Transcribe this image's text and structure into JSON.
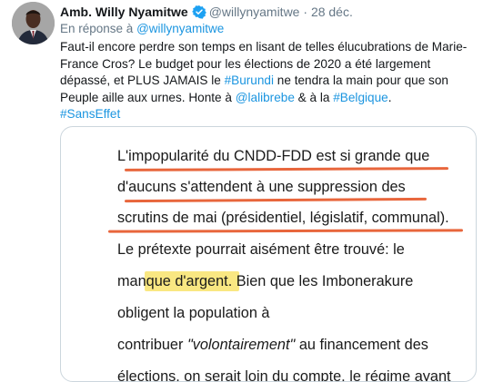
{
  "tweet": {
    "author_name": "Amb. Willy Nyamitwe",
    "verified_icon": "verified-badge-icon",
    "handle": "@willynyamitwe",
    "separator": "·",
    "date": "28 déc.",
    "reply_prefix": "En réponse à",
    "reply_handle": "@willynyamitwe",
    "text_1": "Faut-il encore perdre son temps en lisant de telles élucubrations de Marie-France Cros? Le budget pour les élections de 2020 a été largement dépassé, et PLUS JAMAIS le ",
    "hashtag_burundi": "#Burundi",
    "text_2": " ne tendra la main pour que son Peuple aille aux urnes. Honte à ",
    "mention_lalibrebe": "@lalibrebe",
    "text_3": " & à la ",
    "hashtag_belgique": "#Belgique",
    "text_4": ".",
    "hashtag_sanseffet": "#SansEffet",
    "accent_color": "#1b95e0"
  },
  "media": {
    "lines": [
      "L'impopularité du CNDD-FDD est si grande que",
      "d'aucuns s'attendent à une suppression des",
      "scrutins de mai (présidentiel, législatif, communal).",
      "Le prétexte pourrait aisément être trouvé: le",
      "manque d'argent. Bien que les Imbonerakure",
      "obligent la population à",
      "contribuer ",
      "\"volontairement\"",
      " au financement des",
      "élections, on serait loin du compte, le régime ayant"
    ],
    "underline_color": "#e8663c",
    "highlight_color": "#f8e36c"
  }
}
